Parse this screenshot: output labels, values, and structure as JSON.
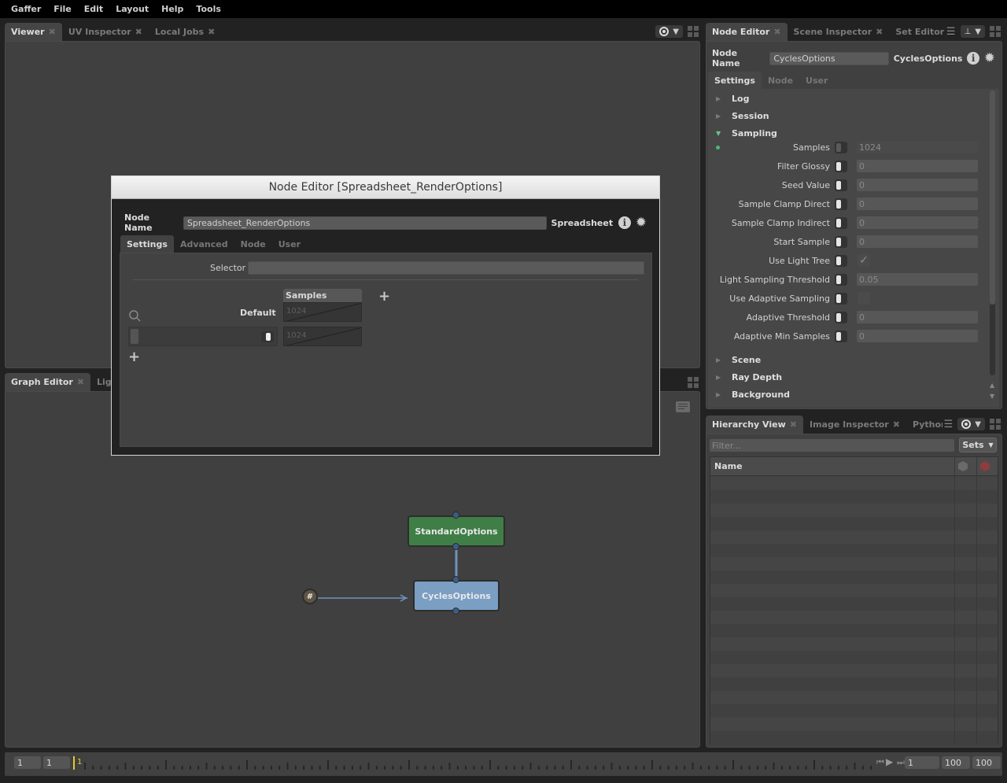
{
  "menubar": [
    "Gaffer",
    "File",
    "Edit",
    "Layout",
    "Help",
    "Tools"
  ],
  "viewer": {
    "tabs": [
      {
        "label": "Viewer",
        "active": true
      },
      {
        "label": "UV Inspector",
        "active": false
      },
      {
        "label": "Local Jobs",
        "active": false
      }
    ]
  },
  "graph_editor": {
    "tabs": [
      {
        "label": "Graph Editor",
        "active": true
      },
      {
        "label": "Ligh",
        "active": false
      }
    ],
    "nodes": [
      {
        "name": "StandardOptions",
        "color": "#3f7f47"
      },
      {
        "name": "CyclesOptions",
        "color": "#7b9ec3"
      }
    ],
    "expression_node": "#",
    "colors": {
      "connection": "#6f93bd",
      "expr_node": "#5f5443"
    }
  },
  "node_editor": {
    "tabs": [
      {
        "label": "Node Editor",
        "active": true
      },
      {
        "label": "Scene Inspector",
        "active": false
      },
      {
        "label": "Set Editor",
        "active": false
      }
    ],
    "node_name_label": "Node Name",
    "node_name_value": "CyclesOptions",
    "node_type": "CyclesOptions",
    "subtabs": [
      "Settings",
      "Node",
      "User"
    ],
    "sections_before": [
      "Log",
      "Session"
    ],
    "open_section": "Sampling",
    "plugs": [
      {
        "name": "Samples",
        "value": "1024",
        "kind": "field",
        "enabled": true
      },
      {
        "name": "Filter Glossy",
        "value": "0",
        "kind": "field",
        "enabled": false
      },
      {
        "name": "Seed Value",
        "value": "0",
        "kind": "field",
        "enabled": false
      },
      {
        "name": "Sample Clamp Direct",
        "value": "0",
        "kind": "field",
        "enabled": false
      },
      {
        "name": "Sample Clamp Indirect",
        "value": "0",
        "kind": "field",
        "enabled": false
      },
      {
        "name": "Start Sample",
        "value": "0",
        "kind": "field",
        "enabled": false
      },
      {
        "name": "Use Light Tree",
        "value": "✓",
        "kind": "check",
        "enabled": false
      },
      {
        "name": "Light Sampling Threshold",
        "value": "0.05",
        "kind": "field",
        "enabled": false
      },
      {
        "name": "Use Adaptive Sampling",
        "value": "",
        "kind": "check",
        "enabled": false
      },
      {
        "name": "Adaptive Threshold",
        "value": "0",
        "kind": "field",
        "enabled": false
      },
      {
        "name": "Adaptive Min Samples",
        "value": "0",
        "kind": "field",
        "enabled": false
      }
    ],
    "sections_after": [
      "Scene",
      "Ray Depth",
      "Background"
    ]
  },
  "hierarchy": {
    "tabs": [
      {
        "label": "Hierarchy View",
        "active": true
      },
      {
        "label": "Image Inspector",
        "active": false
      },
      {
        "label": "Python E",
        "active": false
      }
    ],
    "filter_placeholder": "Filter...",
    "sets_label": "Sets",
    "column_name": "Name"
  },
  "dialog": {
    "title": "Node Editor [Spreadsheet_RenderOptions]",
    "node_name_label": "Node Name",
    "node_name_value": "Spreadsheet_RenderOptions",
    "node_type": "Spreadsheet",
    "subtabs": [
      "Settings",
      "Advanced",
      "Node",
      "User"
    ],
    "selector_label": "Selector",
    "selector_value": "",
    "column_header": "Samples",
    "default_label": "Default",
    "default_value": "1024",
    "row_value": "1024"
  },
  "timeline": {
    "start": "1",
    "end": "1",
    "current_marker": "1",
    "current_frame": "1",
    "range_end": "100",
    "global_end": "100",
    "accent": "#e6c92a"
  }
}
